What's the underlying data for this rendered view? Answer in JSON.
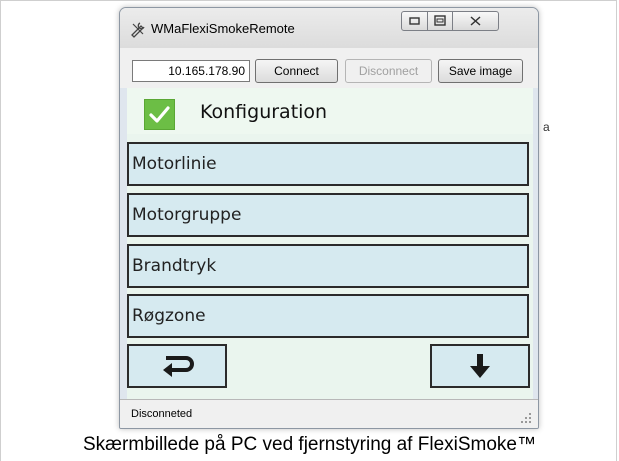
{
  "window": {
    "title": "WMaFlexiSmokeRemote",
    "icon": "wrench-pencil-icon"
  },
  "connection": {
    "ip_value": "10.165.178.90",
    "connect_label": "Connect",
    "disconnect_label": "Disconnect",
    "save_label": "Save image"
  },
  "header": {
    "label": "Konfiguration",
    "icon": "checkmark-icon",
    "accent_color": "#6cbe45"
  },
  "menu": {
    "items": [
      {
        "label": "Motorlinie"
      },
      {
        "label": "Motorgruppe"
      },
      {
        "label": "Brandtryk"
      },
      {
        "label": "Røgzone"
      }
    ]
  },
  "nav": {
    "back_icon": "return-arrow-icon",
    "down_icon": "arrow-down-icon"
  },
  "status": {
    "text": "Disconneted"
  },
  "background": {
    "letter": "a"
  },
  "caption": "Skærmbillede på PC ved fjernstyring af FlexiSmoke™"
}
